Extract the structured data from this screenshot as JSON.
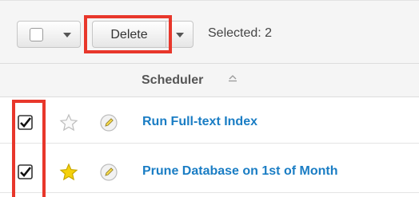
{
  "toolbar": {
    "delete_label": "Delete",
    "selected_text": "Selected: 2"
  },
  "table": {
    "column_header": "Scheduler",
    "rows": [
      {
        "name": "Run Full-text Index",
        "checked": true,
        "favorite": false
      },
      {
        "name": "Prune Database on 1st of Month",
        "checked": true,
        "favorite": true
      }
    ]
  },
  "colors": {
    "highlight": "#e8372b",
    "link": "#1a7dc4",
    "favorite_star": "#f5d10a"
  },
  "icons": [
    "checkbox-icon",
    "chevron-down-icon",
    "sort-icon",
    "star-icon",
    "pencil-icon"
  ]
}
